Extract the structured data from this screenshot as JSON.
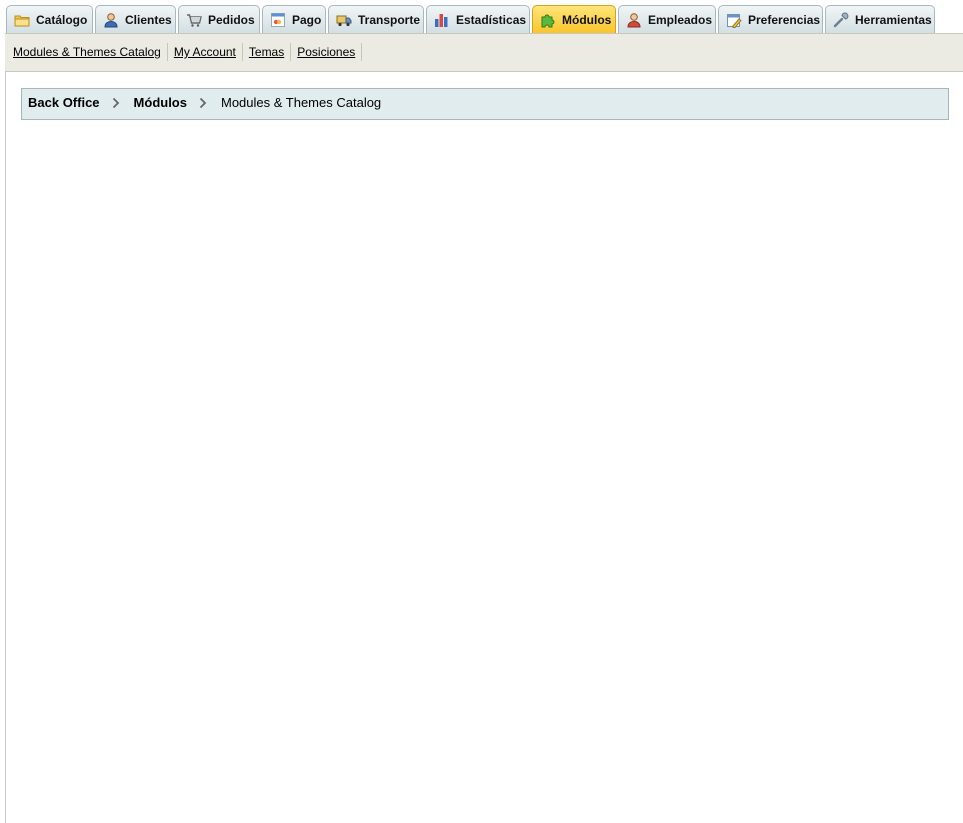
{
  "tabs": [
    {
      "label": "Catálogo",
      "icon": "folder-icon",
      "active": false
    },
    {
      "label": "Clientes",
      "icon": "customer-icon",
      "active": false
    },
    {
      "label": "Pedidos",
      "icon": "cart-icon",
      "active": false
    },
    {
      "label": "Pago",
      "icon": "payment-icon",
      "active": false
    },
    {
      "label": "Transporte",
      "icon": "truck-icon",
      "active": false
    },
    {
      "label": "Estadísticas",
      "icon": "bar-chart-icon",
      "active": false
    },
    {
      "label": "Módulos",
      "icon": "puzzle-icon",
      "active": true
    },
    {
      "label": "Empleados",
      "icon": "employee-icon",
      "active": false
    },
    {
      "label": "Preferencias",
      "icon": "preferences-icon",
      "active": false
    },
    {
      "label": "Herramientas",
      "icon": "wrench-icon",
      "active": false
    }
  ],
  "subnav": {
    "items": [
      "Modules & Themes Catalog",
      "My Account",
      "Temas",
      "Posiciones"
    ]
  },
  "breadcrumb": {
    "root": "Back Office",
    "section": "Módulos",
    "current": "Modules & Themes Catalog"
  },
  "colors": {
    "active_tab": "#f8c52c",
    "tab": "#dde7ea",
    "subnav_bg": "#ecebe3",
    "breadcrumb_bg": "#e1ecee"
  }
}
